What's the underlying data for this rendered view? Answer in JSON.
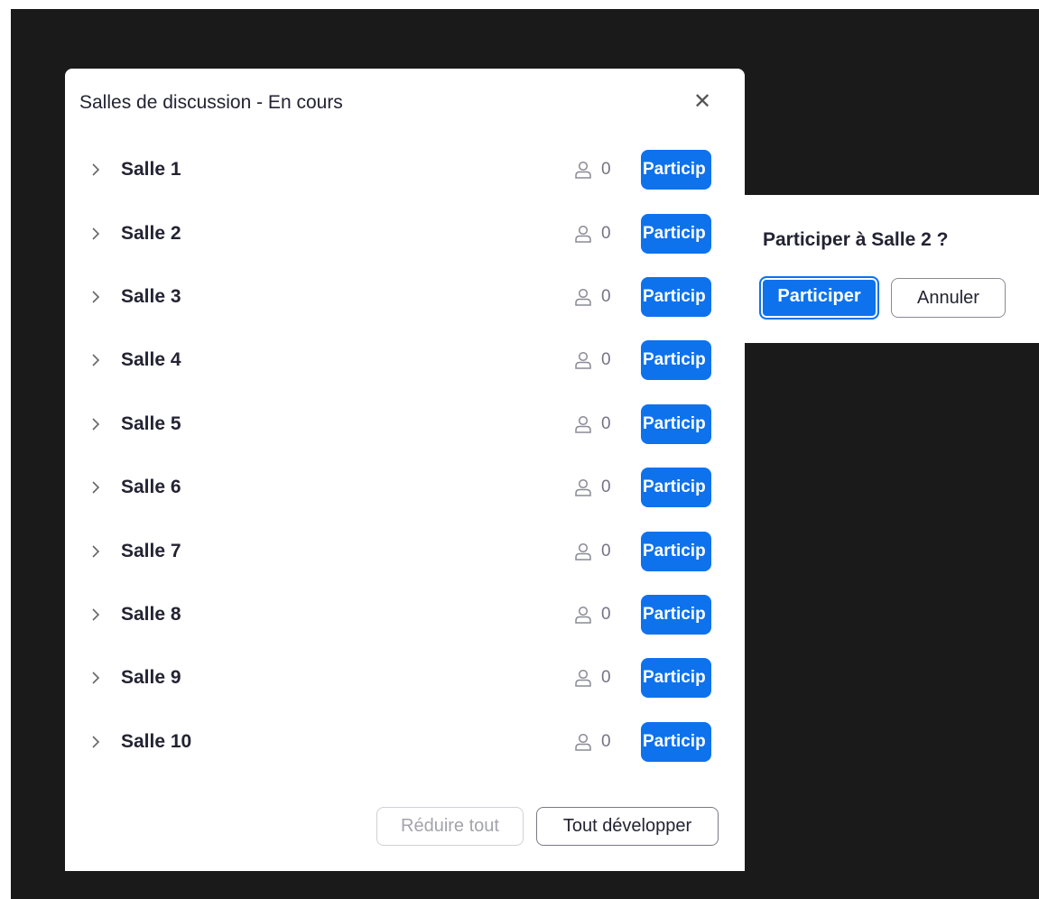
{
  "dialog": {
    "title": "Salles de discussion - En cours",
    "close_icon": "close-icon"
  },
  "rooms": [
    {
      "name": "Salle 1",
      "participants": "0",
      "join_label": "Particip"
    },
    {
      "name": "Salle 2",
      "participants": "0",
      "join_label": "Particip"
    },
    {
      "name": "Salle 3",
      "participants": "0",
      "join_label": "Particip"
    },
    {
      "name": "Salle 4",
      "participants": "0",
      "join_label": "Particip"
    },
    {
      "name": "Salle 5",
      "participants": "0",
      "join_label": "Particip"
    },
    {
      "name": "Salle 6",
      "participants": "0",
      "join_label": "Particip"
    },
    {
      "name": "Salle 7",
      "participants": "0",
      "join_label": "Particip"
    },
    {
      "name": "Salle 8",
      "participants": "0",
      "join_label": "Particip"
    },
    {
      "name": "Salle 9",
      "participants": "0",
      "join_label": "Particip"
    },
    {
      "name": "Salle 10",
      "participants": "0",
      "join_label": "Particip"
    }
  ],
  "footer": {
    "collapse_label": "Réduire tout",
    "expand_label": "Tout développer"
  },
  "popover": {
    "question": "Participer à Salle 2 ?",
    "confirm_label": "Participer",
    "cancel_label": "Annuler"
  },
  "colors": {
    "accent": "#0e72ed",
    "backdrop": "#1a1a1a"
  }
}
